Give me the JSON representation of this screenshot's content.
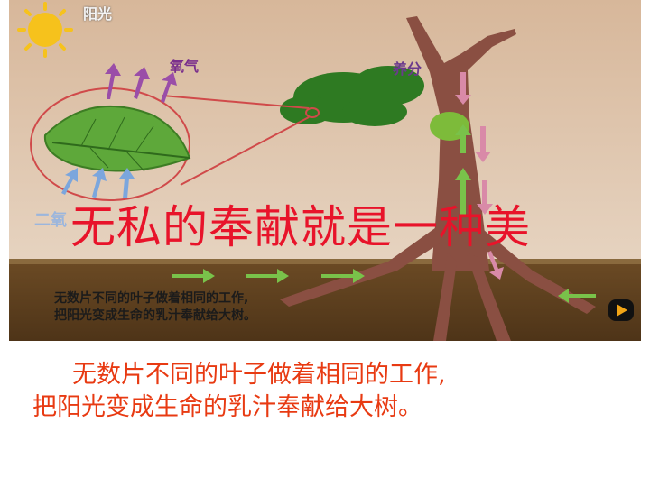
{
  "video": {
    "labels": {
      "sunlight": "阳光",
      "oxygen": "氧气",
      "nutrients": "养分",
      "carbon_dioxide": "二氧"
    },
    "overlay_title": "无私的奉献就是一种美",
    "caption_lines": [
      "无数片不同的叶子做着相同的工作,",
      "把阳光变成生命的乳汁奉献给大树。"
    ],
    "play_icon": "play-icon"
  },
  "caption": {
    "lines": [
      "无数片不同的叶子做着相同的工作,",
      "把阳光变成生命的乳汁奉献给大树。"
    ]
  },
  "colors": {
    "title_red": "#e8132a",
    "caption_orange": "#e83a12"
  }
}
